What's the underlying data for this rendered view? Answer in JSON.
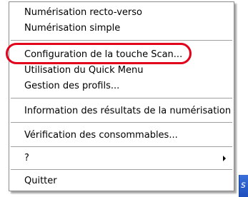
{
  "menu": {
    "items": [
      {
        "label": "Numérisation recto-verso"
      },
      {
        "label": "Numérisation simple"
      },
      {
        "label": "Configuration de la touche Scan..."
      },
      {
        "label": "Utilisation du Quick Menu"
      },
      {
        "label": "Gestion des profils..."
      },
      {
        "label": "Information des résultats de la numérisation"
      },
      {
        "label": "Vérification des consommables..."
      },
      {
        "label": "?",
        "has_submenu": true,
        "submenu_icon": "chevron-right-icon"
      },
      {
        "label": "Quitter"
      }
    ],
    "highlighted_item": "Configuration de la touche Scan..."
  },
  "taskbar": {
    "glyph": "s"
  },
  "colors": {
    "highlight_ring": "#e3001b",
    "menu_border": "#8c8c8c",
    "taskbar": "#2f63d1"
  }
}
